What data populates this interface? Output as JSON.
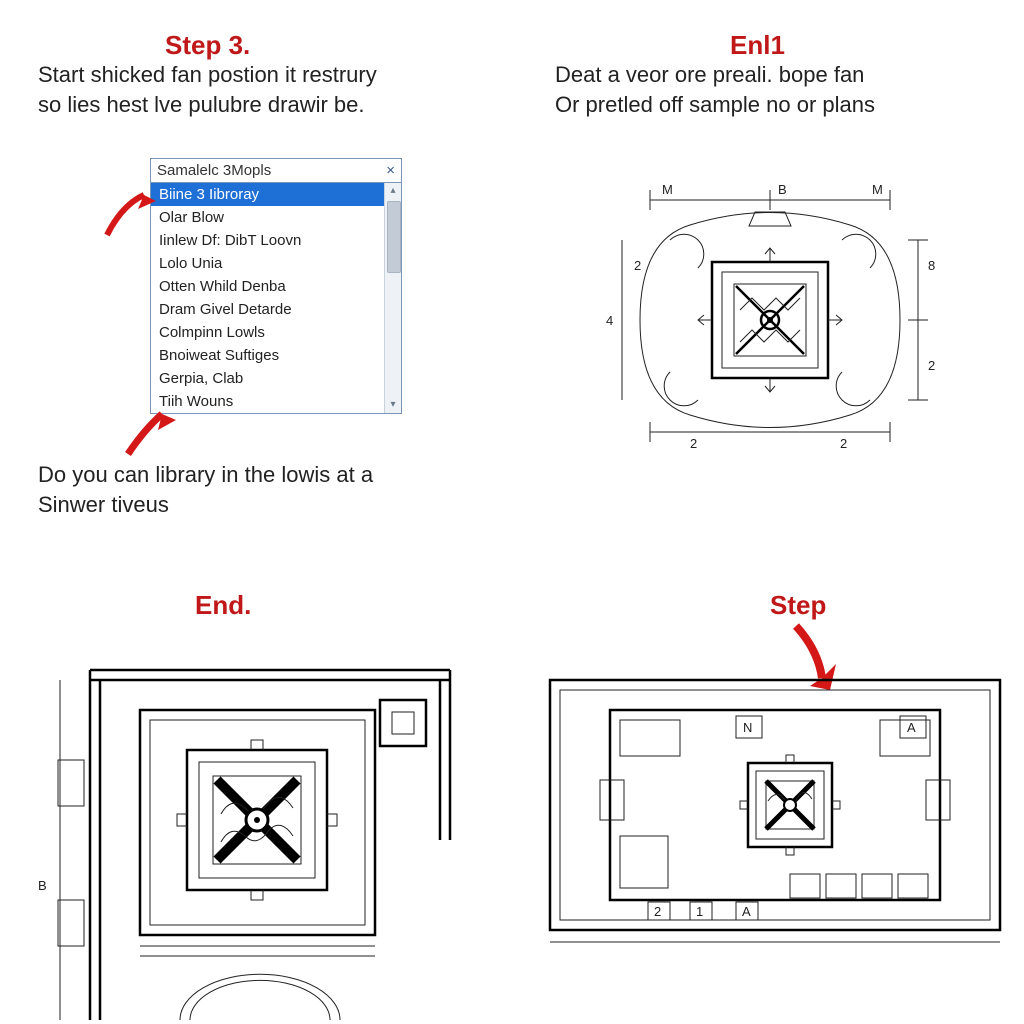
{
  "q1": {
    "title": "Step 3.",
    "text": "Start shicked fan postion it restrury\nso lies hest lve pulubre drawir be.",
    "dropdown": {
      "title": "Samalelc 3Mopls",
      "items": [
        {
          "label": "Biine 3 Iibroray",
          "selected": true
        },
        {
          "label": "Olar Blow"
        },
        {
          "label": "Iinlew Df: DibT Loovn"
        },
        {
          "label": "Lolo Unia"
        },
        {
          "label": "Otten Whild Denba"
        },
        {
          "label": "Dram Givel Detarde"
        },
        {
          "label": "Colmpinn Lowls"
        },
        {
          "label": "Bnoiweat Suftiges"
        },
        {
          "label": "Gerpia, Clab"
        },
        {
          "label": "Tiih Wouns"
        }
      ]
    },
    "caption": "Do you can library in the lowis at a\nSinwer tiveus"
  },
  "q2": {
    "title": "Enl1",
    "text": "Deat a veor ore preali. bope fan\nOr pretled off sample no or plans",
    "dims": {
      "top_left": "M",
      "top_mid": "B",
      "top_right": "M",
      "r_upper": "8",
      "r_lower": "2",
      "left": "4",
      "b_left": "2",
      "b_right": "2",
      "l_upper": "2"
    }
  },
  "q3": {
    "title": "End.",
    "dims": {
      "left": "B"
    }
  },
  "q4": {
    "title": "Step",
    "dims": {
      "top_l": "N",
      "top_r": "A",
      "bot_a": "2",
      "bot_b": "1",
      "bot_c": "A"
    }
  }
}
